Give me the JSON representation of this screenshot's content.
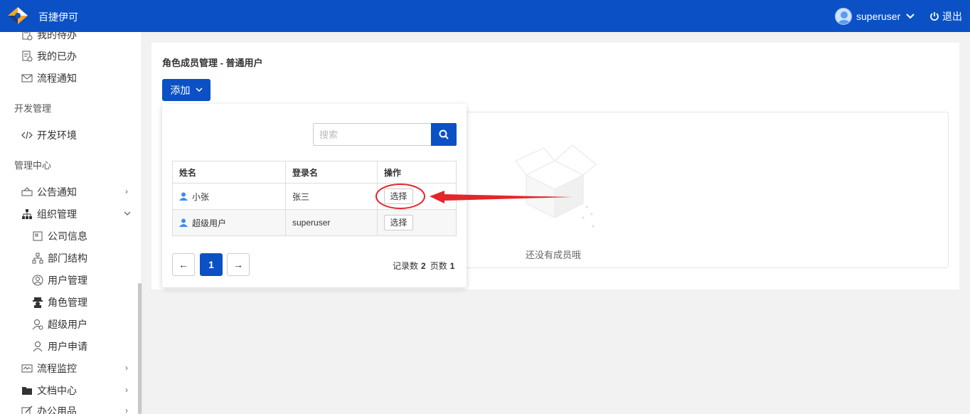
{
  "header": {
    "brand": "百捷伊可",
    "username": "superuser",
    "logout": "退出"
  },
  "sidebar": {
    "items_top": [
      {
        "label": "我的待办"
      },
      {
        "label": "我的已办"
      },
      {
        "label": "流程通知"
      }
    ],
    "group_dev": "开发管理",
    "dev_env": "开发环境",
    "group_admin": "管理中心",
    "notice": "公告通知",
    "org": "组织管理",
    "org_children": [
      {
        "label": "公司信息"
      },
      {
        "label": "部门结构"
      },
      {
        "label": "用户管理"
      },
      {
        "label": "角色管理"
      },
      {
        "label": "超级用户"
      },
      {
        "label": "用户申请"
      }
    ],
    "flow_monitor": "流程监控",
    "docs": "文档中心",
    "office": "办公用品"
  },
  "main": {
    "title": "角色成员管理 - 普通用户",
    "add_button": "添加",
    "empty_text": "还没有成员哦"
  },
  "popup": {
    "search_placeholder": "搜索",
    "columns": [
      "姓名",
      "登录名",
      "操作"
    ],
    "rows": [
      {
        "name": "小张",
        "login": "张三",
        "action": "选择"
      },
      {
        "name": "超级用户",
        "login": "superuser",
        "action": "选择"
      }
    ],
    "pagination": {
      "prev": "←",
      "current": "1",
      "next": "→"
    },
    "records_label": "记录数",
    "records_count": "2",
    "pages_label": "页数",
    "pages_count": "1"
  },
  "colors": {
    "primary": "#0b51c5",
    "annotation": "#e3262b"
  }
}
